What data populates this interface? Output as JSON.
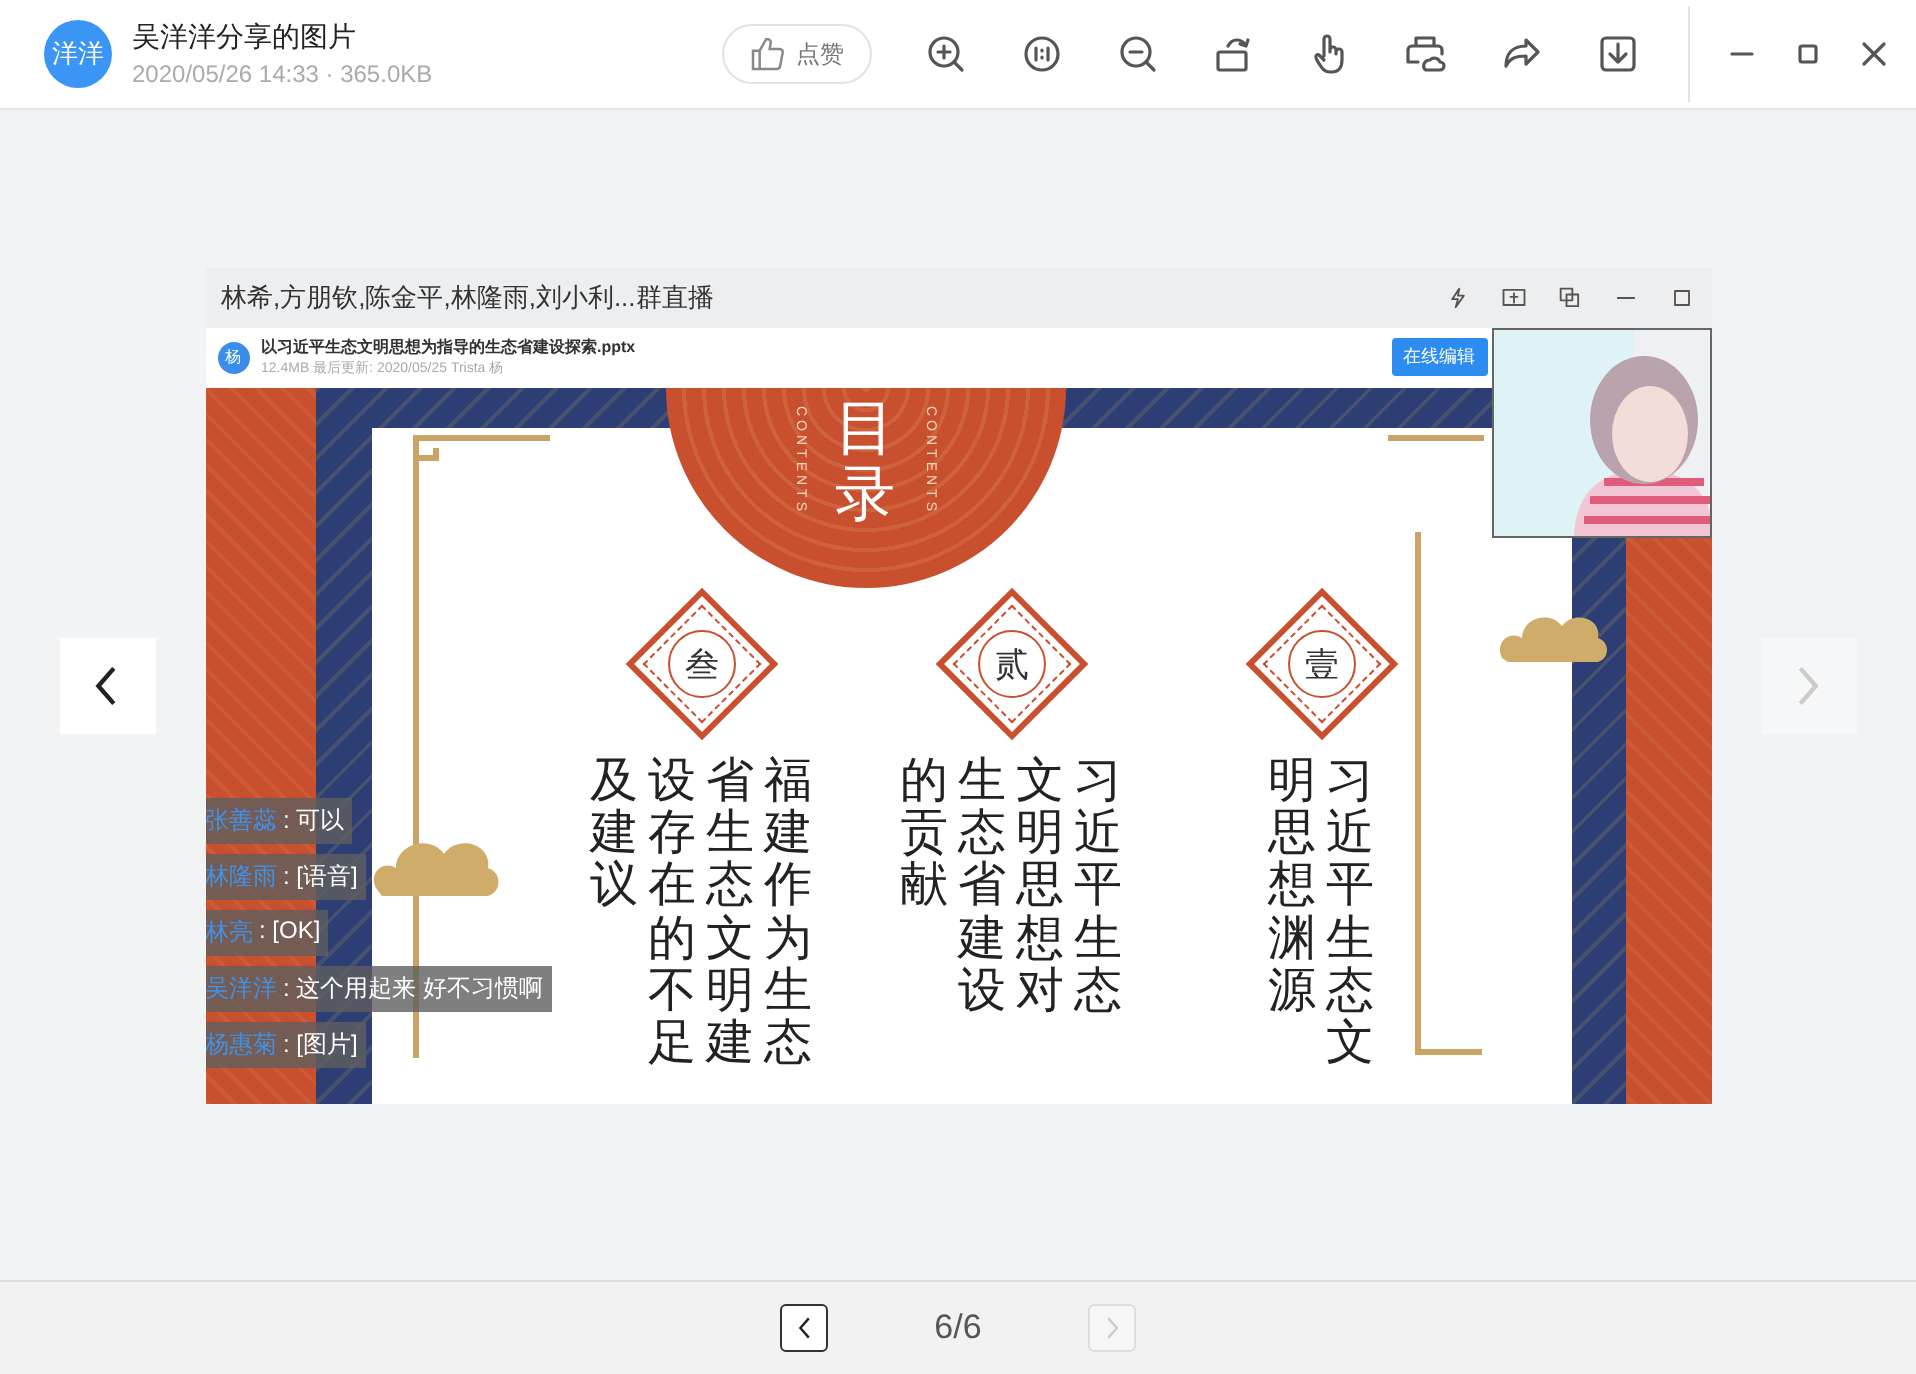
{
  "header": {
    "avatar": "洋洋",
    "title": "吴洋洋分享的图片",
    "meta": "2020/05/26 14:33 · 365.0KB",
    "like_button": "点赞"
  },
  "viewer": {
    "prev_disabled": false,
    "next_disabled": true
  },
  "image": {
    "window_title": "林希,方朋钦,陈金平,林隆雨,刘小利...群直播",
    "file": {
      "avatar": "杨",
      "name": "以习近平生态文明思想为指导的生态省建设探索.pptx",
      "meta": "12.4MB  最后更新: 2020/05/25 Trista  杨",
      "edit_button": "在线编辑"
    },
    "slide": {
      "title": "目录",
      "labels": [
        "CONTENTS",
        "CONTENTS"
      ],
      "topics": [
        {
          "numeral": "叁",
          "lines": [
            "及建议",
            "设存在的不足",
            "省生态文明建",
            "福建作为生态"
          ]
        },
        {
          "numeral": "贰",
          "lines": [
            "的贡献",
            "生态省建设",
            "文明思想对",
            "习近平生态"
          ]
        },
        {
          "numeral": "壹",
          "lines": [
            "明思想渊源",
            "习近平生态文"
          ]
        }
      ]
    },
    "chat": [
      {
        "name": "张善蕊",
        "message": ": 可以"
      },
      {
        "name": "林隆雨",
        "message": ": [语音]"
      },
      {
        "name": "林亮",
        "message": ": [OK]"
      },
      {
        "name": "吴洋洋",
        "message": ": 这个用起来 好不习惯啊"
      },
      {
        "name": "杨惠菊",
        "message": ": [图片]"
      }
    ]
  },
  "pager": {
    "text": "6/6",
    "prev_disabled": false,
    "next_disabled": true
  }
}
